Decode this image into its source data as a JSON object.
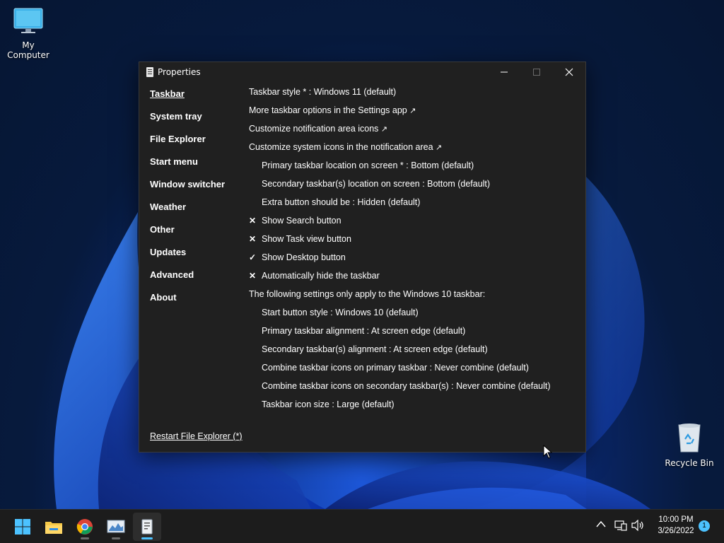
{
  "desktop": {
    "icons": [
      {
        "label": "My Computer"
      },
      {
        "label": "Recycle Bin"
      }
    ]
  },
  "window": {
    "title": "Properties",
    "controls": {
      "minimize": "—",
      "maximize": "☐",
      "close": "✕"
    },
    "sidebar": [
      {
        "label": "Taskbar",
        "active": true
      },
      {
        "label": "System tray"
      },
      {
        "label": "File Explorer"
      },
      {
        "label": "Start menu"
      },
      {
        "label": "Window switcher"
      },
      {
        "label": "Weather"
      },
      {
        "label": "Other"
      },
      {
        "label": "Updates"
      },
      {
        "label": "Advanced"
      },
      {
        "label": "About"
      }
    ],
    "settings": [
      {
        "text": "Taskbar style * : Windows 11 (default)"
      },
      {
        "text": "More taskbar options in the Settings app",
        "arrow": "↗"
      },
      {
        "text": "Customize notification area icons",
        "arrow": "↗"
      },
      {
        "text": "Customize system icons in the notification area",
        "arrow": "↗"
      },
      {
        "text": "Primary taskbar location on screen * : Bottom (default)"
      },
      {
        "text": "Secondary taskbar(s) location on screen : Bottom (default)"
      },
      {
        "text": "Extra button should be : Hidden (default)"
      },
      {
        "text": "Show Search button",
        "mark": "✕"
      },
      {
        "text": "Show Task view button",
        "mark": "✕"
      },
      {
        "text": "Show Desktop button",
        "mark": "✓"
      },
      {
        "text": "Automatically hide the taskbar",
        "mark": "✕"
      },
      {
        "text": "The following settings only apply to the Windows 10 taskbar:"
      },
      {
        "text": "Start button style : Windows 10 (default)"
      },
      {
        "text": "Primary taskbar alignment : At screen edge (default)"
      },
      {
        "text": "Secondary taskbar(s) alignment : At screen edge (default)"
      },
      {
        "text": "Combine taskbar icons on primary taskbar : Never combine (default)"
      },
      {
        "text": "Combine taskbar icons on secondary taskbar(s) : Never combine (default)"
      },
      {
        "text": "Taskbar icon size : Large (default)"
      }
    ],
    "restart_link": "Restart File Explorer (*)"
  },
  "taskbar": {
    "apps": [
      "start-icon",
      "file-explorer-icon",
      "chrome-icon",
      "task-manager-icon",
      "properties-app-icon"
    ],
    "clock": {
      "time": "10:00 PM",
      "date": "3/26/2022"
    },
    "notification_count": "1",
    "tray": {
      "chevron": "^"
    }
  },
  "colors": {
    "accent": "#4cc2ff",
    "window_bg": "#202020",
    "taskbar_bg": "#1c1c1c"
  }
}
